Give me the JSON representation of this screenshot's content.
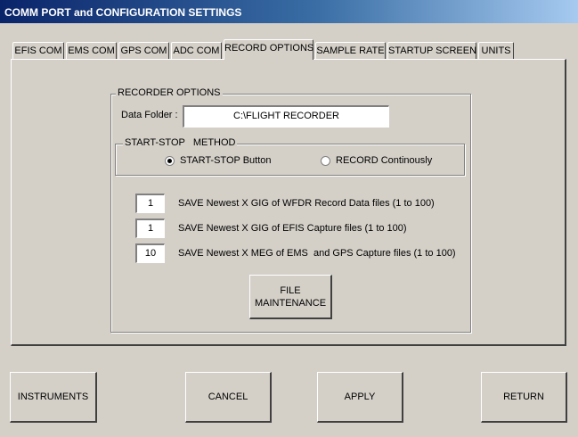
{
  "window": {
    "title": "COMM PORT and CONFIGURATION SETTINGS"
  },
  "tabs": [
    {
      "label": "EFIS COM"
    },
    {
      "label": "EMS COM"
    },
    {
      "label": "GPS COM"
    },
    {
      "label": "ADC COM"
    },
    {
      "label": "RECORD OPTIONS",
      "active": true
    },
    {
      "label": "SAMPLE RATE"
    },
    {
      "label": "STARTUP SCREEN"
    },
    {
      "label": "UNITS"
    }
  ],
  "recorder": {
    "group_label": "RECORDER OPTIONS",
    "data_folder_label": "Data Folder :",
    "data_folder_value": "C:\\FLIGHT RECORDER",
    "method": {
      "group_label": "START-STOP   METHOD",
      "option1": "START-STOP Button",
      "option2": "RECORD Continously",
      "selected": "option1"
    },
    "save_rows": [
      {
        "value": "1",
        "label": "SAVE Newest X GIG of WFDR Record Data files (1 to 100)"
      },
      {
        "value": "1",
        "label": "SAVE Newest X GIG of EFIS Capture files (1 to 100)"
      },
      {
        "value": "10",
        "label": "SAVE Newest X MEG of EMS  and GPS Capture files (1 to 100)"
      }
    ],
    "file_maintenance_line1": "FILE",
    "file_maintenance_line2": "MAINTENANCE"
  },
  "buttons": {
    "instruments": "INSTRUMENTS",
    "cancel": "CANCEL",
    "apply": "APPLY",
    "return": "RETURN"
  },
  "colors": {
    "face": "#d4d0c8",
    "title_start": "#0a246a",
    "title_end": "#a6caf0"
  }
}
